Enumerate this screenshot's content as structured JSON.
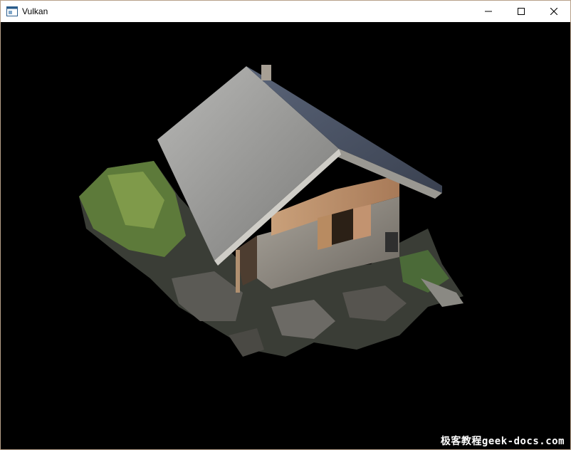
{
  "window": {
    "title": "Vulkan",
    "icon": "app-window-icon",
    "controls": {
      "minimize_icon": "minimize-icon",
      "maximize_icon": "maximize-icon",
      "close_icon": "close-icon"
    }
  },
  "viewport": {
    "background": "#000000",
    "scene": "rendered 3d model"
  },
  "watermark": {
    "text": "极客教程geek-docs.com"
  }
}
